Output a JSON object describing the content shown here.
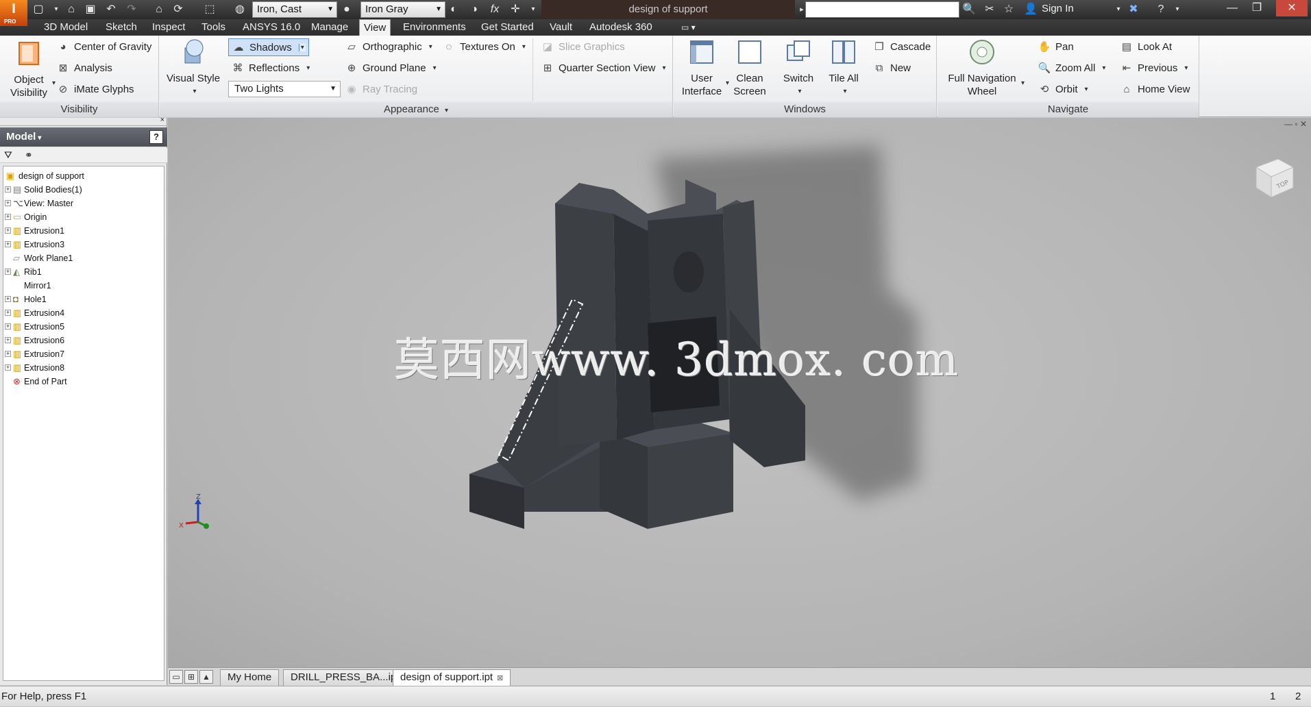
{
  "app": {
    "logo_letter": "I",
    "logo_edition": "PRO"
  },
  "quick_access": {
    "material": "Iron, Cast",
    "appearance": "Iron Gray",
    "fx_label": "fx"
  },
  "title_bar": {
    "document_title": "design of support",
    "sign_in": "Sign In"
  },
  "ribbon_tabs": [
    {
      "label": "3D Model",
      "active": false
    },
    {
      "label": "Sketch",
      "active": false
    },
    {
      "label": "Inspect",
      "active": false
    },
    {
      "label": "Tools",
      "active": false
    },
    {
      "label": "ANSYS 16.0",
      "active": false
    },
    {
      "label": "Manage",
      "active": false
    },
    {
      "label": "View",
      "active": true
    },
    {
      "label": "Environments",
      "active": false
    },
    {
      "label": "Get Started",
      "active": false
    },
    {
      "label": "Vault",
      "active": false
    },
    {
      "label": "Autodesk 360",
      "active": false
    }
  ],
  "ribbon": {
    "visibility": {
      "title": "Visibility",
      "object_visibility": "Object",
      "object_visibility_2": "Visibility",
      "center_of_gravity": "Center of Gravity",
      "analysis": "Analysis",
      "imate_glyphs": "iMate Glyphs"
    },
    "appearance": {
      "title": "Appearance",
      "visual_style": "Visual Style",
      "shadows": "Shadows",
      "reflections": "Reflections",
      "lighting": "Two Lights",
      "orthographic": "Orthographic",
      "ground_plane": "Ground Plane",
      "ray_tracing": "Ray Tracing",
      "textures_on": "Textures On",
      "slice_graphics": "Slice Graphics",
      "quarter_section_view": "Quarter Section View"
    },
    "windows": {
      "title": "Windows",
      "user_interface": "User",
      "user_interface_2": "Interface",
      "clean_screen": "Clean",
      "clean_screen_2": "Screen",
      "switch": "Switch",
      "tile_all": "Tile All",
      "cascade": "Cascade",
      "new": "New"
    },
    "navigate": {
      "title": "Navigate",
      "full_nav_wheel": "Full Navigation",
      "full_nav_wheel_2": "Wheel",
      "pan": "Pan",
      "zoom_all": "Zoom All",
      "orbit": "Orbit",
      "look_at": "Look At",
      "previous": "Previous",
      "home_view": "Home View"
    }
  },
  "browser": {
    "header": "Model",
    "help": "?",
    "tree": [
      {
        "label": "design of support",
        "icon": "part-icon",
        "expandable": false,
        "root": true
      },
      {
        "label": "Solid Bodies(1)",
        "icon": "solid-bodies-icon",
        "expandable": true
      },
      {
        "label": "View: Master",
        "icon": "view-icon",
        "expandable": true
      },
      {
        "label": "Origin",
        "icon": "folder-icon",
        "expandable": true
      },
      {
        "label": "Extrusion1",
        "icon": "extrusion-icon",
        "expandable": true
      },
      {
        "label": "Extrusion3",
        "icon": "extrusion-icon",
        "expandable": true
      },
      {
        "label": "Work Plane1",
        "icon": "work-plane-icon",
        "expandable": false
      },
      {
        "label": "Rib1",
        "icon": "rib-icon",
        "expandable": true
      },
      {
        "label": "Mirror1",
        "icon": "mirror-icon",
        "expandable": false
      },
      {
        "label": "Hole1",
        "icon": "hole-icon",
        "expandable": true
      },
      {
        "label": "Extrusion4",
        "icon": "extrusion-icon",
        "expandable": true
      },
      {
        "label": "Extrusion5",
        "icon": "extrusion-icon",
        "expandable": true
      },
      {
        "label": "Extrusion6",
        "icon": "extrusion-icon",
        "expandable": true
      },
      {
        "label": "Extrusion7",
        "icon": "extrusion-icon",
        "expandable": true
      },
      {
        "label": "Extrusion8",
        "icon": "extrusion-icon",
        "expandable": true
      },
      {
        "label": "End of Part",
        "icon": "end-of-part-icon",
        "expandable": false
      }
    ]
  },
  "viewport": {
    "watermark": "莫西网www. 3dmox. com",
    "viewcube_face": "TOP",
    "triad": {
      "x": "X",
      "z": "Z"
    },
    "colors": {
      "part": "#3a3d42",
      "part_light": "#4b4e54",
      "background": "#b8b8b8",
      "shadow": "#6e6e6e"
    }
  },
  "doc_tabs": [
    {
      "label": "My Home",
      "active": false
    },
    {
      "label": "DRILL_PRESS_BA...ipt",
      "active": false
    },
    {
      "label": "design of support.ipt",
      "active": true
    }
  ],
  "status_bar": {
    "help_text": "For Help, press F1",
    "num1": "1",
    "num2": "2"
  }
}
